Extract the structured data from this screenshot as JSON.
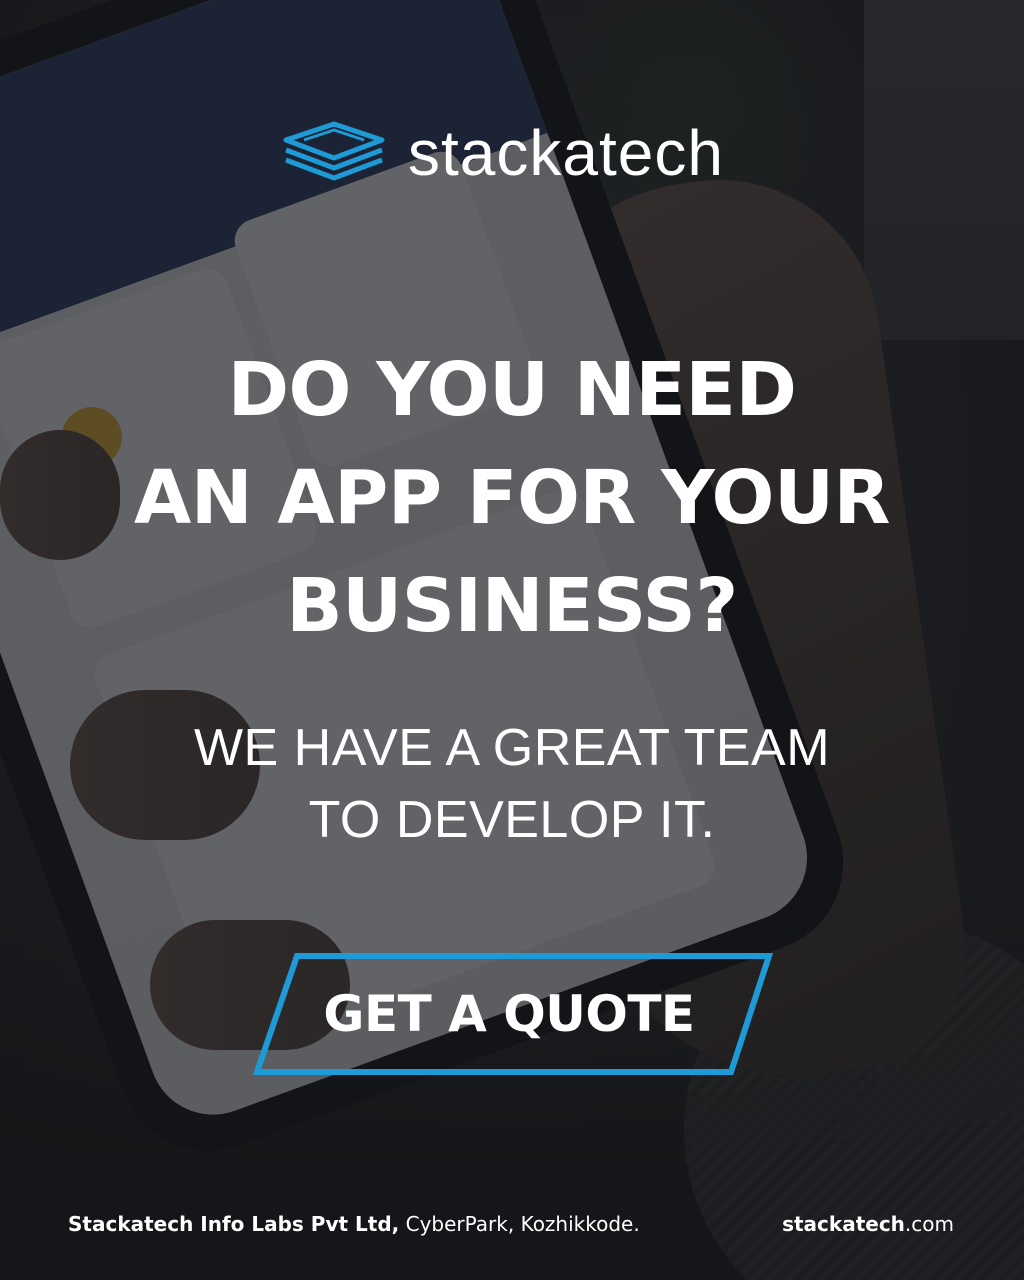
{
  "brand": {
    "name": "stackatech",
    "accent_color": "#1e9ad6",
    "icon": "stacked-layers-logo-icon"
  },
  "headline": {
    "lines": [
      "DO YOU NEED",
      "AN APP FOR YOUR",
      "BUSINESS?"
    ]
  },
  "subline": {
    "lines": [
      "WE HAVE A GREAT TEAM",
      "TO DEVELOP IT."
    ]
  },
  "cta": {
    "label": "GET A QUOTE",
    "border_color": "#1e9ad6"
  },
  "footer": {
    "company": "Stackatech Info Labs Pvt Ltd,",
    "address": " CyberPark, Kozhikkode.",
    "domain_bold": "stackatech",
    "domain_rest": ".com"
  }
}
